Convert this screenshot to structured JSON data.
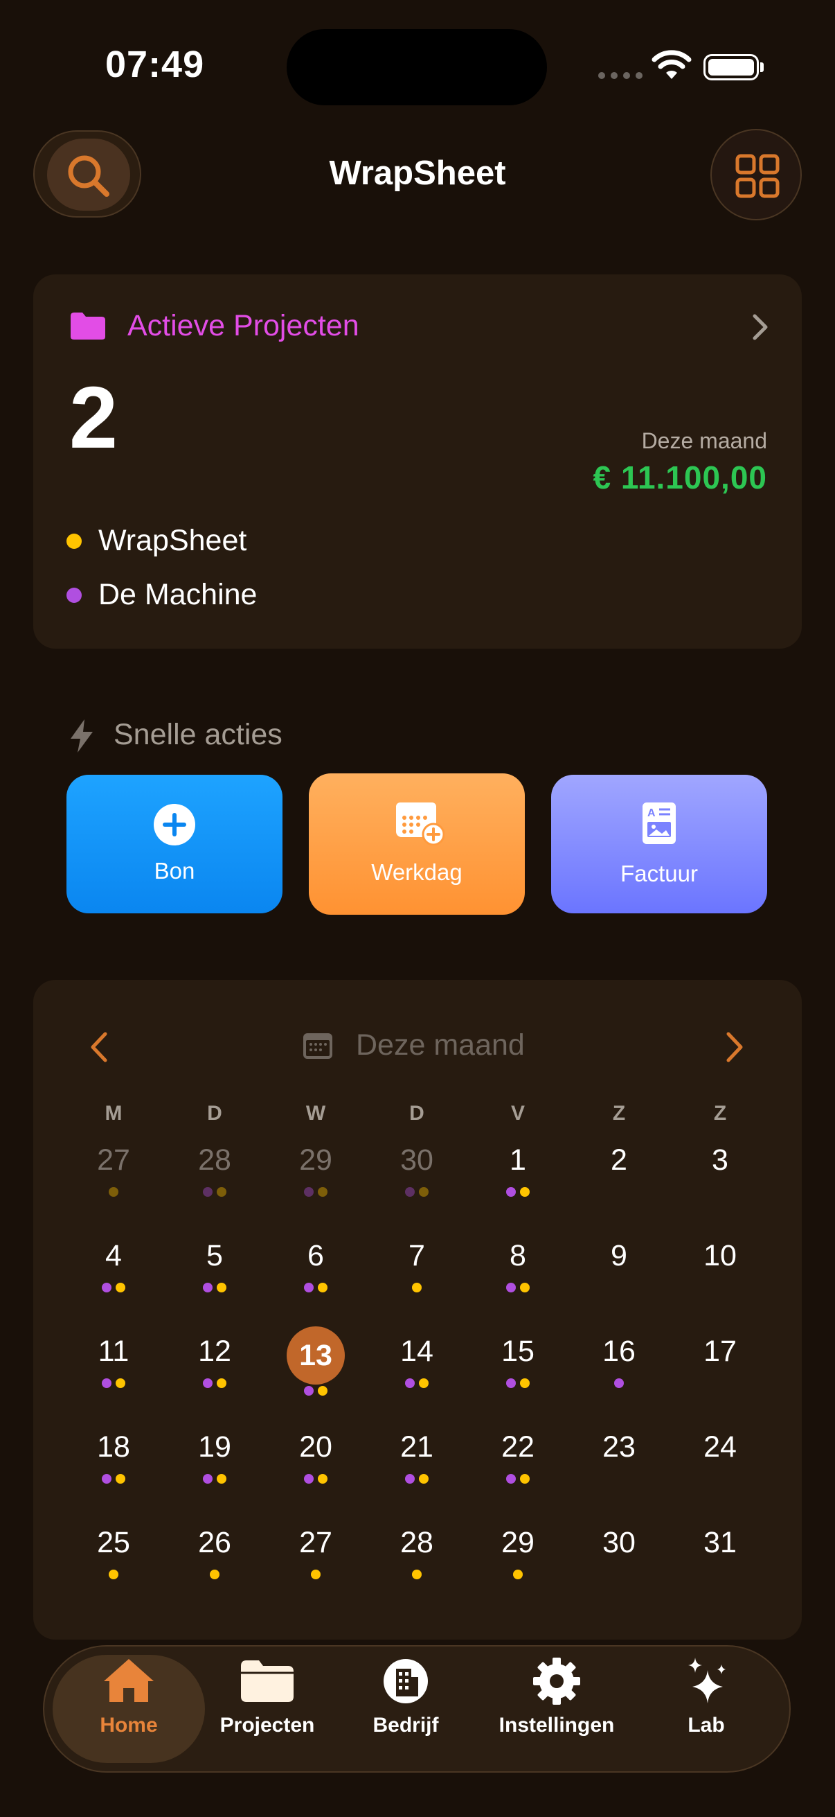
{
  "status": {
    "time": "07:49"
  },
  "header": {
    "title": "WrapSheet"
  },
  "projects": {
    "title": "Actieve Projecten",
    "count": "2",
    "month_label": "Deze maand",
    "month_amount": "€ 11.100,00",
    "items": [
      {
        "name": "WrapSheet",
        "color": "#ffc400"
      },
      {
        "name": "De Machine",
        "color": "#b04fe0"
      }
    ]
  },
  "quick": {
    "title": "Snelle acties",
    "buttons": [
      {
        "label": "Bon",
        "icon": "plus-circle-icon"
      },
      {
        "label": "Werkdag",
        "icon": "calendar-add-icon"
      },
      {
        "label": "Factuur",
        "icon": "invoice-icon"
      }
    ]
  },
  "calendar": {
    "title": "Deze maand",
    "weekdays": [
      "M",
      "D",
      "W",
      "D",
      "V",
      "Z",
      "Z"
    ],
    "colors": {
      "yellow": "#ffc400",
      "purple": "#b04fe0",
      "today": "#c1672a"
    },
    "weeks": [
      [
        {
          "d": "27",
          "o": true,
          "dots": [
            "y"
          ]
        },
        {
          "d": "28",
          "o": true,
          "dots": [
            "p",
            "y"
          ]
        },
        {
          "d": "29",
          "o": true,
          "dots": [
            "p",
            "y"
          ]
        },
        {
          "d": "30",
          "o": true,
          "dots": [
            "p",
            "y"
          ]
        },
        {
          "d": "1",
          "dots": [
            "p",
            "y"
          ]
        },
        {
          "d": "2",
          "dots": []
        },
        {
          "d": "3",
          "dots": []
        }
      ],
      [
        {
          "d": "4",
          "dots": [
            "p",
            "y"
          ]
        },
        {
          "d": "5",
          "dots": [
            "p",
            "y"
          ]
        },
        {
          "d": "6",
          "dots": [
            "p",
            "y"
          ]
        },
        {
          "d": "7",
          "dots": [
            "y"
          ]
        },
        {
          "d": "8",
          "dots": [
            "p",
            "y"
          ]
        },
        {
          "d": "9",
          "dots": []
        },
        {
          "d": "10",
          "dots": []
        }
      ],
      [
        {
          "d": "11",
          "dots": [
            "p",
            "y"
          ]
        },
        {
          "d": "12",
          "dots": [
            "p",
            "y"
          ]
        },
        {
          "d": "13",
          "today": true,
          "dots": [
            "p",
            "y"
          ]
        },
        {
          "d": "14",
          "dots": [
            "p",
            "y"
          ]
        },
        {
          "d": "15",
          "dots": [
            "p",
            "y"
          ]
        },
        {
          "d": "16",
          "dots": [
            "p"
          ]
        },
        {
          "d": "17",
          "dots": []
        }
      ],
      [
        {
          "d": "18",
          "dots": [
            "p",
            "y"
          ]
        },
        {
          "d": "19",
          "dots": [
            "p",
            "y"
          ]
        },
        {
          "d": "20",
          "dots": [
            "p",
            "y"
          ]
        },
        {
          "d": "21",
          "dots": [
            "p",
            "y"
          ]
        },
        {
          "d": "22",
          "dots": [
            "p",
            "y"
          ]
        },
        {
          "d": "23",
          "dots": []
        },
        {
          "d": "24",
          "dots": []
        }
      ],
      [
        {
          "d": "25",
          "dots": [
            "y"
          ]
        },
        {
          "d": "26",
          "dots": [
            "y"
          ]
        },
        {
          "d": "27",
          "dots": [
            "y"
          ]
        },
        {
          "d": "28",
          "dots": [
            "y"
          ]
        },
        {
          "d": "29",
          "dots": [
            "y"
          ]
        },
        {
          "d": "30",
          "dots": []
        },
        {
          "d": "31",
          "dots": []
        }
      ]
    ]
  },
  "tabs": [
    {
      "label": "Home",
      "icon": "home-icon",
      "active": true
    },
    {
      "label": "Projecten",
      "icon": "folder-icon"
    },
    {
      "label": "Bedrijf",
      "icon": "building-icon"
    },
    {
      "label": "Instellingen",
      "icon": "gear-icon"
    },
    {
      "label": "Lab",
      "icon": "sparkles-icon"
    }
  ],
  "accent": "#c1672a"
}
